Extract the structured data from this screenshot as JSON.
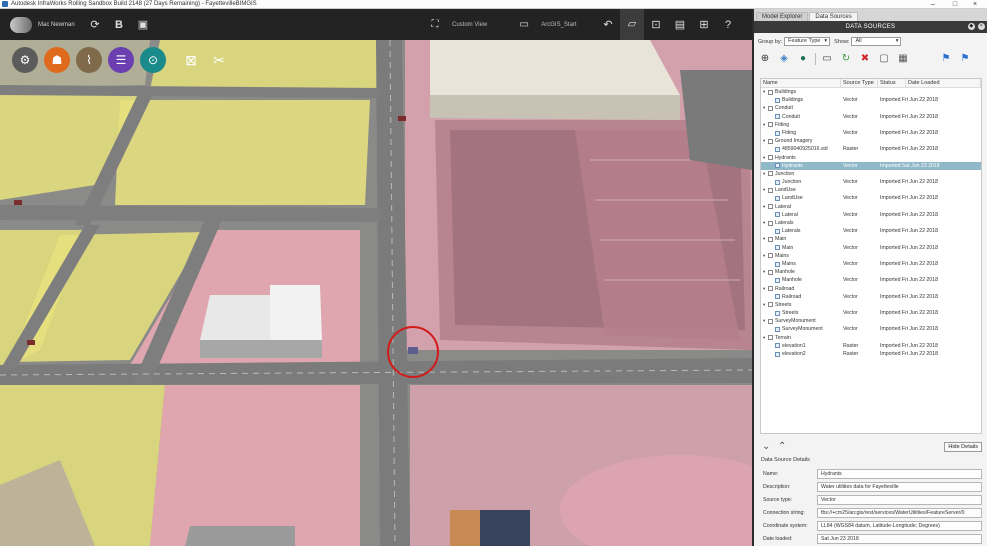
{
  "window": {
    "title": "Autodesk InfraWorks Rolling Sandbox Build 2148 (27 Days Remaining) - FayettevilleBIMGIS",
    "controls": [
      "–",
      "□",
      "×"
    ]
  },
  "toolbar": {
    "user_name": "Mac Newman",
    "left_icons": [
      "sync-icon",
      "bold-b-icon",
      "cube-icon"
    ],
    "left_glyphs": [
      "⟳",
      "B",
      "▣"
    ],
    "view_label": "Custom View",
    "layer_label": "ArcGIS_Start",
    "right_glyphs": [
      "↶",
      "▱",
      "⊡",
      "▤",
      "⊞",
      "?"
    ]
  },
  "map_tools": {
    "glyphs": [
      "⚙",
      "☗",
      "⌇",
      "☰",
      "⊙",
      "⊠",
      "✂"
    ],
    "colors": [
      "#5b5b5b",
      "#e06a1c",
      "#7f6a4a",
      "#6b3fb0",
      "#1a8a8a"
    ]
  },
  "panel": {
    "tabs": [
      "Model Explorer",
      "Data Sources"
    ],
    "active_tab": "Data Sources",
    "header": "DATA SOURCES",
    "group_by_label": "Group by:",
    "group_by_value": "Feature Type",
    "show_label": "Show:",
    "show_value": "All",
    "toolbar_glyphs": [
      "⊕",
      "◈",
      "●",
      "▭",
      "↻",
      "✖",
      "▢",
      "▦",
      "⚑",
      "⚑"
    ],
    "columns": [
      "Name",
      "Source Type",
      "Status",
      "Date Loaded"
    ],
    "tree": [
      {
        "level": 0,
        "name": "Buildings"
      },
      {
        "level": 1,
        "name": "Buildings",
        "type": "Vector",
        "status": "Imported Fri Jun 22 2018"
      },
      {
        "level": 0,
        "name": "Conduit"
      },
      {
        "level": 1,
        "name": "Conduit",
        "type": "Vector",
        "status": "Imported Fri Jun 22 2018"
      },
      {
        "level": 0,
        "name": "Fitting"
      },
      {
        "level": 1,
        "name": "Fitting",
        "type": "Vector",
        "status": "Imported Fri Jun 22 2018"
      },
      {
        "level": 0,
        "name": "Ground Imagery"
      },
      {
        "level": 1,
        "name": "4859040925016.sid",
        "type": "Raster",
        "status": "Imported Fri Jun 22 2018"
      },
      {
        "level": 0,
        "name": "Hydrants"
      },
      {
        "level": 1,
        "name": "Hydrants",
        "type": "Vector",
        "status": "Imported Sat Jun 23 2018",
        "selected": true
      },
      {
        "level": 0,
        "name": "Junction"
      },
      {
        "level": 1,
        "name": "Junction",
        "type": "Vector",
        "status": "Imported Fri Jun 22 2018"
      },
      {
        "level": 0,
        "name": "LandUse"
      },
      {
        "level": 1,
        "name": "LandUse",
        "type": "Vector",
        "status": "Imported Fri Jun 22 2018"
      },
      {
        "level": 0,
        "name": "Lateral"
      },
      {
        "level": 1,
        "name": "Lateral",
        "type": "Vector",
        "status": "Imported Fri Jun 22 2018"
      },
      {
        "level": 0,
        "name": "Laterals"
      },
      {
        "level": 1,
        "name": "Laterals",
        "type": "Vector",
        "status": "Imported Fri Jun 22 2018"
      },
      {
        "level": 0,
        "name": "Main"
      },
      {
        "level": 1,
        "name": "Main",
        "type": "Vector",
        "status": "Imported Fri Jun 22 2018"
      },
      {
        "level": 0,
        "name": "Mains"
      },
      {
        "level": 1,
        "name": "Mains",
        "type": "Vector",
        "status": "Imported Fri Jun 22 2018"
      },
      {
        "level": 0,
        "name": "Manhole"
      },
      {
        "level": 1,
        "name": "Manhole",
        "type": "Vector",
        "status": "Imported Fri Jun 22 2018"
      },
      {
        "level": 0,
        "name": "Railroad"
      },
      {
        "level": 1,
        "name": "Railroad",
        "type": "Vector",
        "status": "Imported Fri Jun 22 2018"
      },
      {
        "level": 0,
        "name": "Streets"
      },
      {
        "level": 1,
        "name": "Streets",
        "type": "Vector",
        "status": "Imported Fri Jun 22 2018"
      },
      {
        "level": 0,
        "name": "SurveyMonument"
      },
      {
        "level": 1,
        "name": "SurveyMonument",
        "type": "Vector",
        "status": "Imported Fri Jun 22 2018"
      },
      {
        "level": 0,
        "name": "Terrain"
      },
      {
        "level": 1,
        "name": "elevation1",
        "type": "Raster",
        "status": "Imported Fri Jun 22 2018"
      },
      {
        "level": 1,
        "name": "elevation2",
        "type": "Raster",
        "status": "Imported Fri Jun 22 2018"
      }
    ],
    "hide_details": "Hide Details",
    "details_title": "Data Source Details",
    "details": [
      {
        "label": "Name:",
        "value": "Hydrants"
      },
      {
        "label": "Description:",
        "value": "Water utilities data for Fayetteville"
      },
      {
        "label": "Source type:",
        "value": "Vector"
      },
      {
        "label": "Connection string:",
        "value": "fbs://+cm25/arcgis/rest/services/WaterUtilities/FeatureServer/0"
      },
      {
        "label": "Coordinate system:",
        "value": "LL84 (WGS84 datum, Latitude-Longitude; Degrees)"
      },
      {
        "label": "Date loaded:",
        "value": "Sat Jun 23 2018"
      }
    ],
    "expand_glyphs": [
      "⌄",
      "⌃"
    ]
  }
}
